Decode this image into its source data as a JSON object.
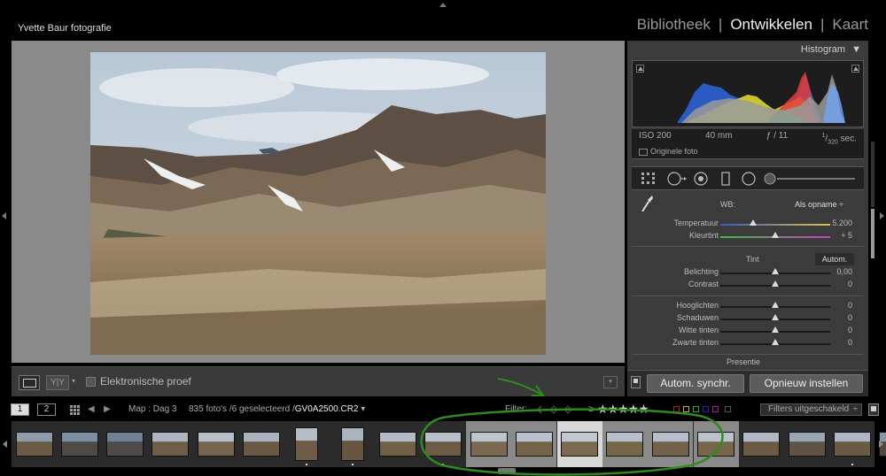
{
  "identity_plate": "Yvette Baur fotografie",
  "modules": [
    {
      "label": "Bibliotheek",
      "active": false
    },
    {
      "label": "Ontwikkelen",
      "active": true
    },
    {
      "label": "Kaart",
      "active": false
    }
  ],
  "module_separator": "|",
  "toolbar": {
    "yy_label": "Y|Y",
    "caret": "▾",
    "softproof_label": "Elektronische proef",
    "dropdown": "▾"
  },
  "histogram": {
    "title": "Histogram",
    "collapse_glyph": "▼",
    "iso": "ISO 200",
    "focal": "40 mm",
    "aperture": "ƒ / 11",
    "shutter_num": "1",
    "shutter_den": "320",
    "shutter_unit": "sec.",
    "original_label": "Originele foto"
  },
  "basic": {
    "wb_label": "WB:",
    "wb_value": "Als opname",
    "wb_caret": "÷",
    "rows_wb": [
      {
        "label": "Temperatuur",
        "value": "5.200",
        "pos": 0.3,
        "track": "temp"
      },
      {
        "label": "Kleurtint",
        "value": "+ 5",
        "pos": 0.5,
        "track": "tint"
      }
    ],
    "tone_label": "Tint",
    "auto_label": "Autom.",
    "rows_tone": [
      {
        "label": "Belichting",
        "value": "0,00",
        "pos": 0.5
      },
      {
        "label": "Contrast",
        "value": "0",
        "pos": 0.5
      }
    ],
    "rows_light": [
      {
        "label": "Hooglichten",
        "value": "0",
        "pos": 0.5
      },
      {
        "label": "Schaduwen",
        "value": "0",
        "pos": 0.5
      },
      {
        "label": "Witte tinten",
        "value": "0",
        "pos": 0.5
      },
      {
        "label": "Zwarte tinten",
        "value": "0",
        "pos": 0.5
      }
    ],
    "presence_label": "Presentie"
  },
  "buttons": {
    "sync": "Autom. synchr.",
    "reset": "Opnieuw instellen"
  },
  "filmbar": {
    "page1": "1",
    "page2": "2",
    "path": "Map : Dag 3",
    "count": "835 foto's /6 geselecteerd /",
    "filename": "GV0A2500.CR2",
    "filename_caret": "▾",
    "filter_label": "Filter:",
    "rating_op": "≥",
    "stars": "★★★★★",
    "filters_off": "Filters uitgeschakeld",
    "filters_caret": "÷"
  },
  "filmstrip": [
    {
      "state": "normal",
      "orient": "land",
      "tone": "#6b5a45",
      "sky": "#8d9bab",
      "dot": false
    },
    {
      "state": "normal",
      "orient": "land",
      "tone": "#4f4a44",
      "sky": "#7c8ea4",
      "dot": false
    },
    {
      "state": "normal",
      "orient": "land",
      "tone": "#4e4b48",
      "sky": "#6f7f96",
      "dot": false
    },
    {
      "state": "normal",
      "orient": "land",
      "tone": "#6e5d47",
      "sky": "#aab5bf",
      "dot": false
    },
    {
      "state": "normal",
      "orient": "land",
      "tone": "#75654f",
      "sky": "#b6bec8",
      "dot": false
    },
    {
      "state": "normal",
      "orient": "land",
      "tone": "#6a5942",
      "sky": "#a9b3bd",
      "dot": false
    },
    {
      "state": "normal",
      "orient": "port",
      "tone": "#6e5c46",
      "sky": "#b5bdc7",
      "dot": true
    },
    {
      "state": "normal",
      "orient": "port",
      "tone": "#66563f",
      "sky": "#aab4be",
      "dot": true
    },
    {
      "state": "normal",
      "orient": "land",
      "tone": "#716047",
      "sky": "#b2bbc6",
      "dot": false
    },
    {
      "state": "normal",
      "orient": "land",
      "tone": "#6d5c45",
      "sky": "#b7bfc9",
      "dot": true
    },
    {
      "state": "sel",
      "orient": "land",
      "tone": "#7a6850",
      "sky": "#bcc4cd",
      "dot": false
    },
    {
      "state": "sel",
      "orient": "land",
      "tone": "#756349",
      "sky": "#b9c2cc",
      "dot": false
    },
    {
      "state": "active",
      "orient": "land",
      "tone": "#7c6951",
      "sky": "#c0c8d1",
      "dot": false
    },
    {
      "state": "sel",
      "orient": "land",
      "tone": "#776548",
      "sky": "#b7c0ca",
      "dot": false
    },
    {
      "state": "sel",
      "orient": "land",
      "tone": "#73624b",
      "sky": "#b6bfc9",
      "dot": false
    },
    {
      "state": "sel",
      "orient": "land",
      "tone": "#786649",
      "sky": "#bac3cc",
      "dot": false
    },
    {
      "state": "normal",
      "orient": "land",
      "tone": "#6c5b44",
      "sky": "#b0b9c3",
      "dot": false
    },
    {
      "state": "normal",
      "orient": "land",
      "tone": "#5e5346",
      "sky": "#9aa6b3",
      "dot": false
    },
    {
      "state": "normal",
      "orient": "land",
      "tone": "#6a5a43",
      "sky": "#aeb7c1",
      "dot": true
    },
    {
      "state": "normal",
      "orient": "land",
      "tone": "#4f4740",
      "sky": "#8797a8",
      "dot": false
    }
  ],
  "colors": {
    "annotation": "#2e8b1e",
    "panel": "#3b3b3b",
    "selected_cell": "#8a8a8a",
    "active_cell": "#d8d8d8"
  }
}
